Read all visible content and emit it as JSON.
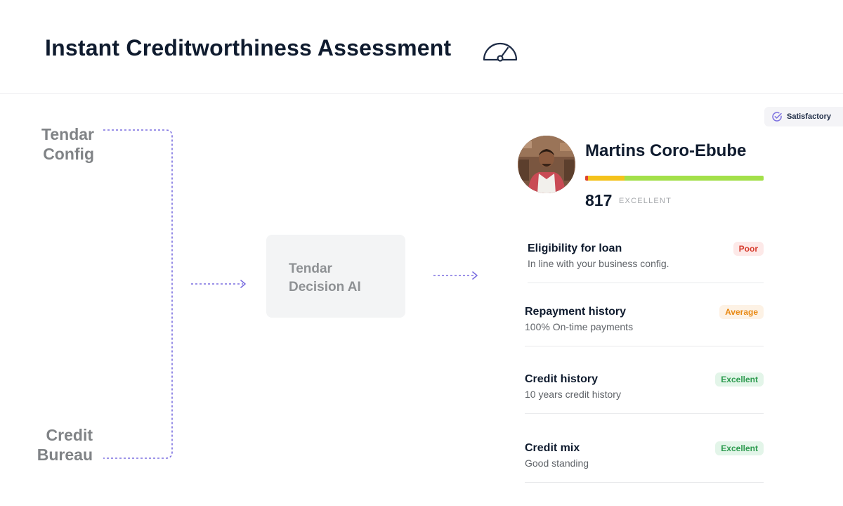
{
  "header": {
    "title": "Instant Creditworthiness Assessment",
    "icon": "gauge-icon"
  },
  "sources": [
    {
      "line1": "Tendar",
      "line2": "Config"
    },
    {
      "line1": "Credit",
      "line2": "Bureau"
    }
  ],
  "decision_box": {
    "line1": "Tendar",
    "line2": "Decision AI"
  },
  "status_badge": {
    "label": "Satisfactory",
    "icon": "check-circle-icon"
  },
  "profile": {
    "name": "Martins Coro-Ebube",
    "score": "817",
    "score_label": "EXCELLENT"
  },
  "factors": [
    {
      "title": "Eligibility for loan",
      "subtitle": "In line with your business config.",
      "badge": "Poor",
      "level": "poor"
    },
    {
      "title": "Repayment history",
      "subtitle": "100% On-time payments",
      "badge": "Average",
      "level": "average"
    },
    {
      "title": "Credit history",
      "subtitle": "10 years credit history",
      "badge": "Excellent",
      "level": "excellent"
    },
    {
      "title": "Credit mix",
      "subtitle": "Good standing",
      "badge": "Excellent",
      "level": "excellent"
    }
  ],
  "colors": {
    "accent": "#7b6fe0",
    "poor": "#d63b2c",
    "average": "#e98a15",
    "excellent": "#2c9a4e"
  }
}
